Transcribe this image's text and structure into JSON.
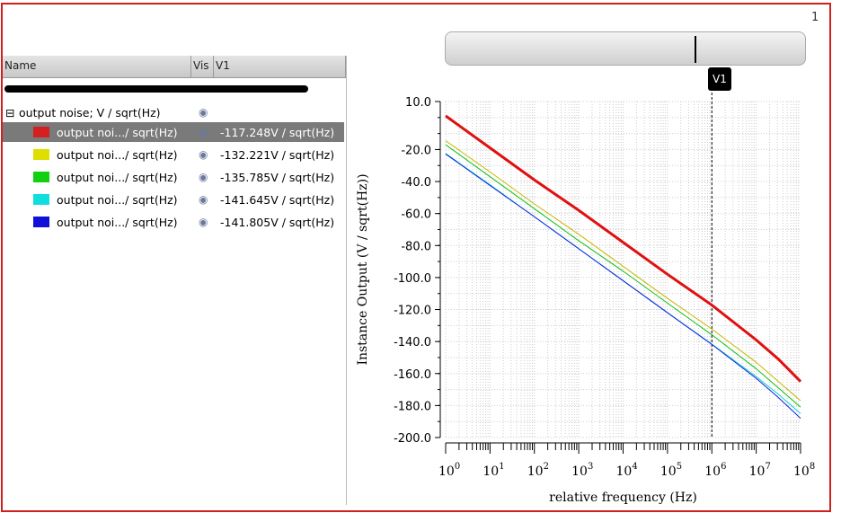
{
  "page_number": "1",
  "tree": {
    "columns": [
      "Name",
      "Vis",
      "V1"
    ],
    "group": "output noise; V / sqrt(Hz)",
    "items": [
      {
        "name": "output noi.../ sqrt(Hz)",
        "value": "-117.248V / sqrt(Hz)",
        "color": "#d42020"
      },
      {
        "name": "output noi.../ sqrt(Hz)",
        "value": "-132.221V / sqrt(Hz)",
        "color": "#dede00"
      },
      {
        "name": "output noi.../ sqrt(Hz)",
        "value": "-135.785V / sqrt(Hz)",
        "color": "#10d010"
      },
      {
        "name": "output noi.../ sqrt(Hz)",
        "value": "-141.645V / sqrt(Hz)",
        "color": "#10dede"
      },
      {
        "name": "output noi.../ sqrt(Hz)",
        "value": "-141.805V / sqrt(Hz)",
        "color": "#1010d8"
      }
    ]
  },
  "marker": {
    "label": "V1",
    "x_log": 6
  },
  "chart_data": {
    "type": "line",
    "xlabel": "relative frequency (Hz)",
    "ylabel": "Instance Output (V / sqrt(Hz))",
    "xscale": "log",
    "xlim_log": [
      0,
      8
    ],
    "ylim": [
      -200,
      10
    ],
    "ytick_labels": [
      "10.0",
      "-20.0",
      "-40.0",
      "-60.0",
      "-80.0",
      "-100.0",
      "-120.0",
      "-140.0",
      "-160.0",
      "-180.0",
      "-200.0"
    ],
    "ytick_values": [
      10,
      -20,
      -40,
      -60,
      -80,
      -100,
      -120,
      -140,
      -160,
      -180,
      -200
    ],
    "xtick_exponents": [
      "0",
      "1",
      "2",
      "3",
      "4",
      "5",
      "6",
      "7",
      "8"
    ],
    "grid": true,
    "x_log": [
      0,
      1,
      2,
      3,
      4,
      5,
      6,
      7,
      7.5,
      8
    ],
    "series": [
      {
        "name": "red",
        "color": "#e01010",
        "width": 3,
        "values": [
          1,
          -19,
          -39,
          -58,
          -78,
          -98,
          -117.2,
          -139,
          -151,
          -165
        ]
      },
      {
        "name": "yellow",
        "color": "#c8b400",
        "width": 1,
        "values": [
          -14.5,
          -34,
          -54,
          -73,
          -93,
          -113,
          -132.2,
          -153,
          -165,
          -177
        ]
      },
      {
        "name": "green",
        "color": "#10c010",
        "width": 1,
        "values": [
          -17,
          -37,
          -57,
          -77,
          -96,
          -116,
          -135.8,
          -157,
          -169,
          -181
        ]
      },
      {
        "name": "cyan",
        "color": "#10d0d0",
        "width": 1,
        "values": [
          -22.5,
          -42,
          -62,
          -82,
          -102,
          -122,
          -141.6,
          -162,
          -173,
          -185
        ]
      },
      {
        "name": "blue",
        "color": "#1020e0",
        "width": 1,
        "values": [
          -22.8,
          -42.5,
          -62,
          -82,
          -102,
          -122,
          -141.8,
          -163,
          -175,
          -188
        ]
      }
    ]
  }
}
